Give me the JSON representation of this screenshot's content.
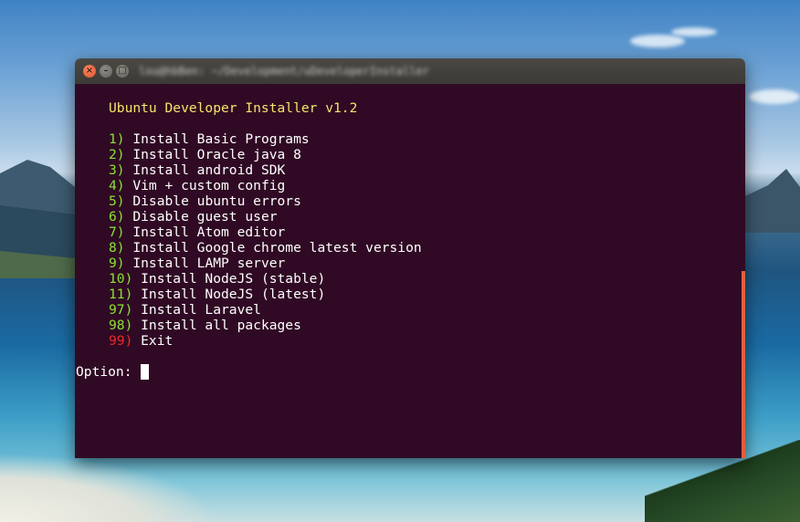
{
  "window": {
    "title": "lou@hbBen: ~/Development/uDeveloperInstaller",
    "buttons": {
      "close": "×",
      "minimize": "–",
      "maximize": "□"
    }
  },
  "terminal": {
    "header": "Ubuntu Developer Installer v1.2",
    "menu": [
      {
        "num": "1)",
        "label": " Install Basic Programs"
      },
      {
        "num": "2)",
        "label": " Install Oracle java 8"
      },
      {
        "num": "3)",
        "label": " Install android SDK"
      },
      {
        "num": "4)",
        "label": " Vim + custom config"
      },
      {
        "num": "5)",
        "label": " Disable ubuntu errors"
      },
      {
        "num": "6)",
        "label": " Disable guest user"
      },
      {
        "num": "7)",
        "label": " Install Atom editor"
      },
      {
        "num": "8)",
        "label": " Install Google chrome latest version"
      },
      {
        "num": "9)",
        "label": " Install LAMP server"
      },
      {
        "num": "10)",
        "label": " Install NodeJS (stable)"
      },
      {
        "num": "11)",
        "label": " Install NodeJS (latest)"
      },
      {
        "num": "97)",
        "label": " Install Laravel"
      },
      {
        "num": "98)",
        "label": " Install all packages"
      },
      {
        "num": "99)",
        "label": " Exit"
      }
    ],
    "prompt": "Option: ",
    "input_value": ""
  },
  "colors": {
    "terminal_bg": "#300a24",
    "header": "#f7e36b",
    "number": "#8ae234",
    "exit_number": "#ef2929",
    "scrollbar": "#e0603b"
  }
}
